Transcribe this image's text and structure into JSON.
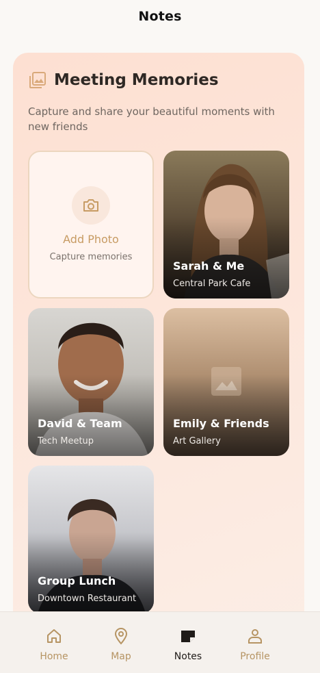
{
  "header": {
    "title": "Notes"
  },
  "section": {
    "title": "Meeting Memories",
    "description": "Capture and share your beautiful moments with new friends"
  },
  "add_tile": {
    "label": "Add Photo",
    "sublabel": "Capture memories"
  },
  "memories": [
    {
      "name": "Sarah & Me",
      "place": "Central Park Cafe"
    },
    {
      "name": "David & Team",
      "place": "Tech Meetup"
    },
    {
      "name": "Emily & Friends",
      "place": "Art Gallery"
    },
    {
      "name": "Group Lunch",
      "place": "Downtown Restaurant"
    }
  ],
  "nav": [
    {
      "label": "Home",
      "icon": "home-icon"
    },
    {
      "label": "Map",
      "icon": "map-pin-icon"
    },
    {
      "label": "Notes",
      "icon": "note-icon",
      "active": true
    },
    {
      "label": "Profile",
      "icon": "person-icon"
    }
  ],
  "colors": {
    "accent": "#c79b63",
    "card_bg": "#fde0d2",
    "nav_inactive": "#b69463"
  }
}
